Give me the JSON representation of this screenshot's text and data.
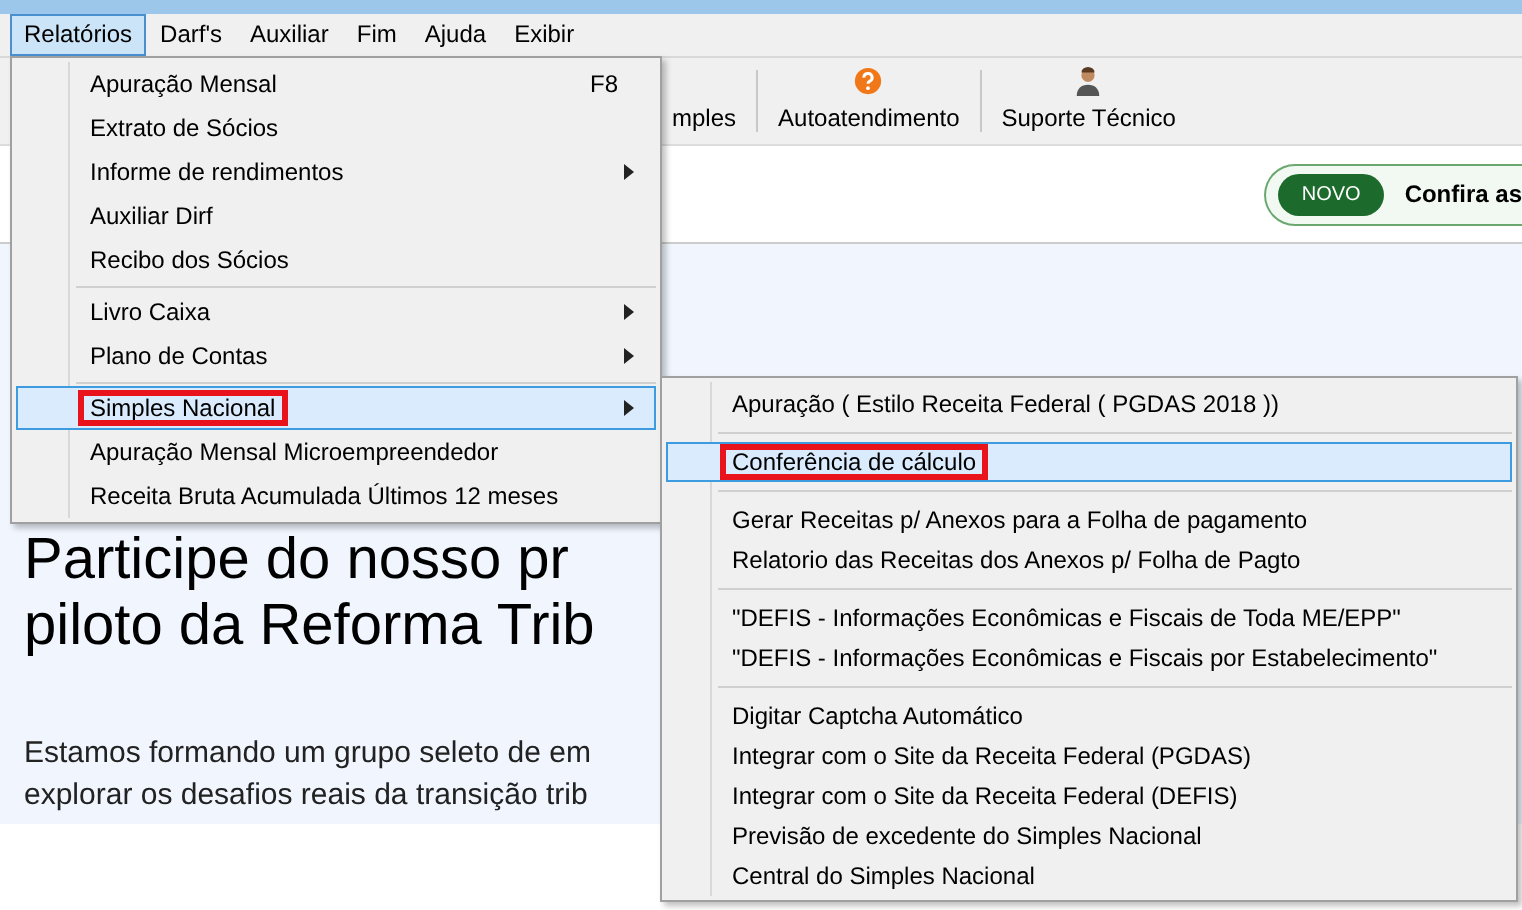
{
  "menubar": [
    {
      "label": "Relatórios",
      "selected": true
    },
    {
      "label": "Darf's",
      "selected": false
    },
    {
      "label": "Auxiliar",
      "selected": false
    },
    {
      "label": "Fim",
      "selected": false
    },
    {
      "label": "Ajuda",
      "selected": false
    },
    {
      "label": "Exibir",
      "selected": false
    }
  ],
  "toolbar": [
    {
      "kind": "text",
      "label": "mples"
    },
    {
      "kind": "help",
      "label": "Autoatendimento"
    },
    {
      "kind": "person",
      "label": "Suporte Técnico"
    }
  ],
  "banner": {
    "badge": "NOVO",
    "text": "Confira as"
  },
  "page": {
    "headline": [
      "Participe do nosso pr",
      "piloto da Reforma Trib"
    ],
    "paragraph": [
      "Estamos formando um grupo seleto de em",
      "explorar os desafios reais da transição trib"
    ]
  },
  "menu": [
    {
      "kind": "item",
      "label": "Apuração Mensal",
      "shortcut": "F8",
      "submenu": false,
      "selected": false,
      "marked": false
    },
    {
      "kind": "item",
      "label": "Extrato de Sócios",
      "submenu": false,
      "selected": false,
      "marked": false
    },
    {
      "kind": "item",
      "label": "Informe de rendimentos",
      "submenu": true,
      "selected": false,
      "marked": false
    },
    {
      "kind": "item",
      "label": "Auxiliar Dirf",
      "submenu": false,
      "selected": false,
      "marked": false
    },
    {
      "kind": "item",
      "label": "Recibo dos Sócios",
      "submenu": false,
      "selected": false,
      "marked": false
    },
    {
      "kind": "separator"
    },
    {
      "kind": "item",
      "label": "Livro Caixa",
      "submenu": true,
      "selected": false,
      "marked": false
    },
    {
      "kind": "item",
      "label": "Plano de Contas",
      "submenu": true,
      "selected": false,
      "marked": false
    },
    {
      "kind": "separator"
    },
    {
      "kind": "item",
      "label": "Simples Nacional",
      "submenu": true,
      "selected": true,
      "marked": true
    },
    {
      "kind": "item",
      "label": "Apuração Mensal Microempreendedor",
      "submenu": false,
      "selected": false,
      "marked": false
    },
    {
      "kind": "item",
      "label": "Receita Bruta Acumulada Últimos 12 meses",
      "submenu": false,
      "selected": false,
      "marked": false
    }
  ],
  "submenu": [
    {
      "kind": "item",
      "label": "Apuração ( Estilo Receita Federal ( PGDAS 2018 ))",
      "selected": false,
      "marked": false
    },
    {
      "kind": "separator"
    },
    {
      "kind": "item",
      "label": "Conferência de cálculo",
      "selected": true,
      "marked": true
    },
    {
      "kind": "separator"
    },
    {
      "kind": "item",
      "label": "Gerar Receitas p/ Anexos para a Folha de pagamento",
      "selected": false,
      "marked": false
    },
    {
      "kind": "item",
      "label": "Relatorio das Receitas dos Anexos p/ Folha de Pagto",
      "selected": false,
      "marked": false
    },
    {
      "kind": "separator"
    },
    {
      "kind": "item",
      "label": "\"DEFIS - Informações Econômicas e Fiscais de Toda ME/EPP\"",
      "selected": false,
      "marked": false
    },
    {
      "kind": "item",
      "label": "\"DEFIS - Informações Econômicas e Fiscais por Estabelecimento\"",
      "selected": false,
      "marked": false
    },
    {
      "kind": "separator"
    },
    {
      "kind": "item",
      "label": "Digitar Captcha Automático",
      "selected": false,
      "marked": false
    },
    {
      "kind": "item",
      "label": "Integrar com o Site da Receita Federal (PGDAS)",
      "selected": false,
      "marked": false
    },
    {
      "kind": "item",
      "label": "Integrar com o Site da Receita Federal (DEFIS)",
      "selected": false,
      "marked": false
    },
    {
      "kind": "item",
      "label": "Previsão de excedente do Simples Nacional",
      "selected": false,
      "marked": false
    },
    {
      "kind": "item",
      "label": "Central do Simples Nacional",
      "selected": false,
      "marked": false
    }
  ]
}
